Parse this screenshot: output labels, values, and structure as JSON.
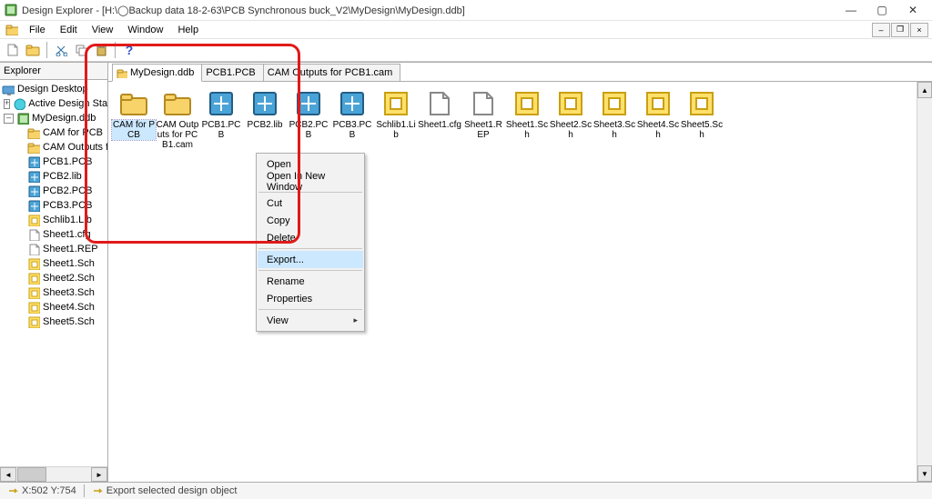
{
  "app_title": "Design Explorer - [H:\\◯Backup data 18-2-63\\PCB Synchronous buck_V2\\MyDesign\\MyDesign.ddb]",
  "menu": {
    "file": "File",
    "edit": "Edit",
    "view": "View",
    "window": "Window",
    "help": "Help"
  },
  "explorer_title": "Explorer",
  "tree": {
    "root": "Design Desktop",
    "stations": "Active Design Stations",
    "ddb": "MyDesign.ddb",
    "children": [
      "CAM for PCB",
      "CAM Outputs for PC",
      "PCB1.PCB",
      "PCB2.lib",
      "PCB2.PCB",
      "PCB3.PCB",
      "Schlib1.Lib",
      "Sheet1.cfg",
      "Sheet1.REP",
      "Sheet1.Sch",
      "Sheet2.Sch",
      "Sheet3.Sch",
      "Sheet4.Sch",
      "Sheet5.Sch"
    ]
  },
  "tabs": {
    "t0": "MyDesign.ddb",
    "t1": "PCB1.PCB",
    "t2": "CAM Outputs for PCB1.cam"
  },
  "grid": [
    {
      "label": "CAM for PCB",
      "type": "cam-folder",
      "sel": true
    },
    {
      "label": "CAM Outputs for PCB1.cam",
      "type": "cam-folder"
    },
    {
      "label": "PCB1.PCB",
      "type": "pcb"
    },
    {
      "label": "PCB2.lib",
      "type": "lib"
    },
    {
      "label": "PCB2.PCB",
      "type": "pcb"
    },
    {
      "label": "PCB3.PCB",
      "type": "pcb"
    },
    {
      "label": "Schlib1.Lib",
      "type": "schlib"
    },
    {
      "label": "Sheet1.cfg",
      "type": "cfg"
    },
    {
      "label": "Sheet1.REP",
      "type": "rep"
    },
    {
      "label": "Sheet1.Sch",
      "type": "sch"
    },
    {
      "label": "Sheet2.Sch",
      "type": "sch"
    },
    {
      "label": "Sheet3.Sch",
      "type": "sch"
    },
    {
      "label": "Sheet4.Sch",
      "type": "sch"
    },
    {
      "label": "Sheet5.Sch",
      "type": "sch"
    }
  ],
  "ctx": {
    "open": "Open",
    "open_new": "Open In New Window",
    "cut": "Cut",
    "copy": "Copy",
    "delete": "Delete",
    "export": "Export...",
    "rename": "Rename",
    "props": "Properties",
    "view": "View"
  },
  "status": {
    "coords": "X:502 Y:754",
    "msg": "Export selected design object"
  }
}
